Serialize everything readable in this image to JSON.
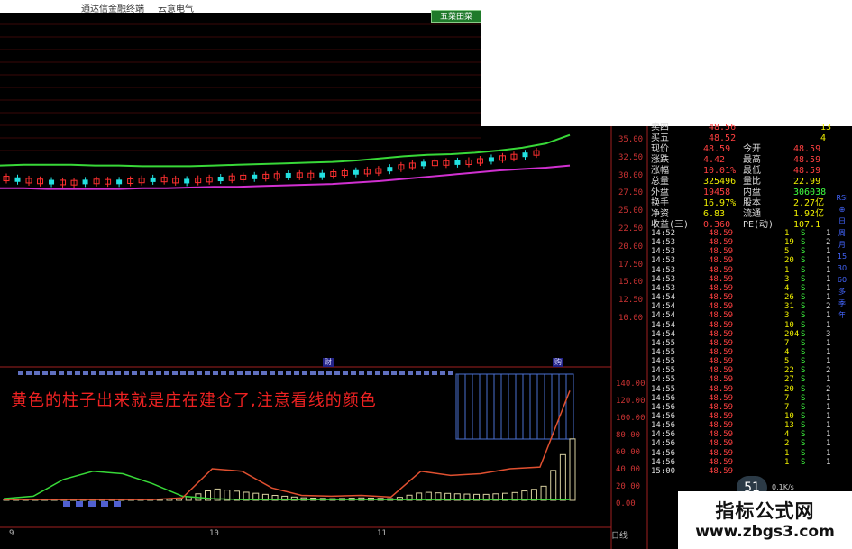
{
  "titlebar": {
    "app_name": "通达信金融终端",
    "stock_name": "云意电气"
  },
  "tab_button": "五菜田菜",
  "price_axis": [
    "35.00",
    "32.50",
    "30.00",
    "27.50",
    "25.00",
    "22.50",
    "20.00",
    "17.50",
    "15.00",
    "12.50",
    "10.00"
  ],
  "indicator_axis": [
    "140.00",
    "120.00",
    "100.00",
    "80.00",
    "60.00",
    "40.00",
    "20.00",
    "0.00"
  ],
  "date_labels": [
    "9",
    "10",
    "11"
  ],
  "chart_markers": {
    "left": "财",
    "right": "购"
  },
  "annotation": "黄色的柱子出来就是庄在建仓了,注意看线的颜色",
  "bottom_tab": "日线",
  "quote": {
    "order_book": [
      {
        "label": "卖四",
        "price": "48.56",
        "vol": "13"
      },
      {
        "label": "买五",
        "price": "48.52",
        "vol": "4"
      }
    ],
    "stats": [
      {
        "l1": "现价",
        "v1": "48.59",
        "l2": "今开",
        "v2": "48.59"
      },
      {
        "l1": "涨跌",
        "v1": "4.42",
        "l2": "最高",
        "v2": "48.59"
      },
      {
        "l1": "涨幅",
        "v1": "10.01%",
        "l2": "最低",
        "v2": "48.59"
      },
      {
        "l1": "总量",
        "v1": "325496",
        "l2": "量比",
        "v2": "22.99"
      },
      {
        "l1": "外盘",
        "v1": "19458",
        "l2": "内盘",
        "v2": "306038"
      },
      {
        "l1": "换手",
        "v1": "16.97%",
        "l2": "股本",
        "v2": "2.27亿"
      },
      {
        "l1": "净资",
        "v1": "6.83",
        "l2": "流通",
        "v2": "1.92亿"
      },
      {
        "l1": "收益(三)",
        "v1": "0.360",
        "l2": "PE(动)",
        "v2": "107.1"
      }
    ],
    "ticks": [
      {
        "time": "14:52",
        "price": "48.59",
        "vol": "1",
        "dir": "S",
        "n": "1"
      },
      {
        "time": "14:53",
        "price": "48.59",
        "vol": "19",
        "dir": "S",
        "n": "2"
      },
      {
        "time": "14:53",
        "price": "48.59",
        "vol": "5",
        "dir": "S",
        "n": "1"
      },
      {
        "time": "14:53",
        "price": "48.59",
        "vol": "20",
        "dir": "S",
        "n": "1"
      },
      {
        "time": "14:53",
        "price": "48.59",
        "vol": "1",
        "dir": "S",
        "n": "1"
      },
      {
        "time": "14:53",
        "price": "48.59",
        "vol": "3",
        "dir": "S",
        "n": "1"
      },
      {
        "time": "14:53",
        "price": "48.59",
        "vol": "4",
        "dir": "S",
        "n": "1"
      },
      {
        "time": "14:54",
        "price": "48.59",
        "vol": "26",
        "dir": "S",
        "n": "1"
      },
      {
        "time": "14:54",
        "price": "48.59",
        "vol": "31",
        "dir": "S",
        "n": "2"
      },
      {
        "time": "14:54",
        "price": "48.59",
        "vol": "3",
        "dir": "S",
        "n": "1"
      },
      {
        "time": "14:54",
        "price": "48.59",
        "vol": "10",
        "dir": "S",
        "n": "1"
      },
      {
        "time": "14:54",
        "price": "48.59",
        "vol": "204",
        "dir": "S",
        "n": "3"
      },
      {
        "time": "14:55",
        "price": "48.59",
        "vol": "7",
        "dir": "S",
        "n": "1"
      },
      {
        "time": "14:55",
        "price": "48.59",
        "vol": "4",
        "dir": "S",
        "n": "1"
      },
      {
        "time": "14:55",
        "price": "48.59",
        "vol": "5",
        "dir": "S",
        "n": "1"
      },
      {
        "time": "14:55",
        "price": "48.59",
        "vol": "22",
        "dir": "S",
        "n": "2"
      },
      {
        "time": "14:55",
        "price": "48.59",
        "vol": "27",
        "dir": "S",
        "n": "1"
      },
      {
        "time": "14:55",
        "price": "48.59",
        "vol": "20",
        "dir": "S",
        "n": "2"
      },
      {
        "time": "14:56",
        "price": "48.59",
        "vol": "7",
        "dir": "S",
        "n": "1"
      },
      {
        "time": "14:56",
        "price": "48.59",
        "vol": "7",
        "dir": "S",
        "n": "1"
      },
      {
        "time": "14:56",
        "price": "48.59",
        "vol": "10",
        "dir": "S",
        "n": "1"
      },
      {
        "time": "14:56",
        "price": "48.59",
        "vol": "13",
        "dir": "S",
        "n": "1"
      },
      {
        "time": "14:56",
        "price": "48.59",
        "vol": "4",
        "dir": "S",
        "n": "1"
      },
      {
        "time": "14:56",
        "price": "48.59",
        "vol": "2",
        "dir": "S",
        "n": "1"
      },
      {
        "time": "14:56",
        "price": "48.59",
        "vol": "1",
        "dir": "S",
        "n": "1"
      },
      {
        "time": "14:56",
        "price": "48.59",
        "vol": "1",
        "dir": "S",
        "n": "1"
      },
      {
        "time": "15:00",
        "price": "48.59",
        "vol": "",
        "dir": "",
        "n": ""
      }
    ]
  },
  "side_icons": [
    "RSI",
    "⊕",
    "日",
    "周",
    "月",
    "15",
    "30",
    "60",
    "多",
    "季",
    "年"
  ],
  "speed_widget": {
    "value": "51",
    "unit": "%",
    "rate": "0.1K/s"
  },
  "watermark": {
    "title": "指标公式网",
    "url": "www.zbgs3.com"
  },
  "colors": {
    "up": "#ff3030",
    "down": "#22e0e0",
    "upper_band": "#38d838",
    "lower_band": "#d030d0",
    "volume_bar": "#d8d0a0",
    "signal_line": "#e05030"
  },
  "chart_data": {
    "type": "line",
    "price_chart": {
      "ylim": [
        10.0,
        36.0
      ],
      "upper_band": [
        31.5,
        31.6,
        31.6,
        31.6,
        31.5,
        31.5,
        31.4,
        31.4,
        31.4,
        31.5,
        31.6,
        31.7,
        31.8,
        31.9,
        32.0,
        32.2,
        32.5,
        32.8,
        33.0,
        33.1,
        33.3,
        33.6,
        34.0,
        34.6,
        35.8
      ],
      "lower_band": [
        28.3,
        28.3,
        28.2,
        28.2,
        28.2,
        28.2,
        28.3,
        28.3,
        28.4,
        28.5,
        28.5,
        28.6,
        28.7,
        28.8,
        28.9,
        29.1,
        29.3,
        29.6,
        29.9,
        30.2,
        30.5,
        30.8,
        31.0,
        31.2,
        31.5
      ],
      "candle_closes": [
        29.6,
        29.3,
        29.1,
        29.0,
        29.2,
        29.1,
        29.3,
        29.5,
        29.2,
        29.4,
        29.6,
        29.8,
        29.9,
        30.1,
        30.0,
        30.3,
        30.5,
        30.7,
        31.3,
        31.7,
        31.8,
        31.9,
        32.3,
        32.7,
        33.2
      ]
    },
    "indicator_chart": {
      "ylim": [
        0,
        145
      ],
      "green_line": [
        2,
        5,
        25,
        35,
        32,
        20,
        5,
        2,
        1,
        1,
        1,
        1,
        1,
        1,
        1,
        1,
        1,
        1,
        1,
        1
      ],
      "orange_line": [
        1,
        1,
        1,
        1,
        1,
        1,
        3,
        38,
        35,
        15,
        6,
        5,
        6,
        4,
        35,
        30,
        32,
        38,
        40,
        132
      ],
      "volume_bars": [
        1,
        1,
        1,
        1,
        1,
        1,
        3,
        14,
        10,
        6,
        3,
        2,
        3,
        2,
        10,
        8,
        7,
        9,
        15,
        74
      ]
    }
  }
}
